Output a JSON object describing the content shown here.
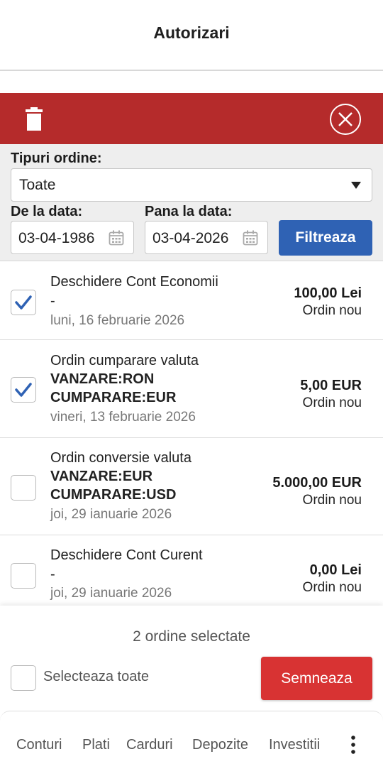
{
  "header": {
    "title": "Autorizari"
  },
  "toolbar": {
    "delete_icon": "trash-icon",
    "close_icon": "close-circle-icon",
    "color": "#b52b2b"
  },
  "filters": {
    "type_label": "Tipuri ordine:",
    "type_value": "Toate",
    "from_label": "De la data:",
    "from_value": "03-04-1986",
    "to_label": "Pana la data:",
    "to_value": "03-04-2026",
    "filter_button": "Filtreaza"
  },
  "orders": [
    {
      "title": "Deschidere Cont Economii",
      "line1": "-",
      "line2": "",
      "date": "luni, 16 februarie 2026",
      "amount": "100,00 Lei",
      "status": "Ordin nou",
      "checked": true
    },
    {
      "title": "Ordin cumparare valuta",
      "line1": "VANZARE:RON",
      "line2": "CUMPARARE:EUR",
      "date": "vineri, 13 februarie 2026",
      "amount": "5,00 EUR",
      "status": "Ordin nou",
      "checked": true
    },
    {
      "title": "Ordin conversie valuta",
      "line1": "VANZARE:EUR",
      "line2": "CUMPARARE:USD",
      "date": "joi, 29 ianuarie 2026",
      "amount": "5.000,00 EUR",
      "status": "Ordin nou",
      "checked": false
    },
    {
      "title": "Deschidere Cont Curent",
      "line1": "-",
      "line2": "",
      "date": "joi, 29 ianuarie 2026",
      "amount": "0,00 Lei",
      "status": "Ordin nou",
      "checked": false
    }
  ],
  "footer": {
    "selected_count": "2 ordine selectate",
    "select_all_label": "Selecteaza toate",
    "sign_button": "Semneaza"
  },
  "nav": {
    "items": [
      "Conturi",
      "Plati",
      "Carduri",
      "Depozite",
      "Investitii"
    ],
    "more_icon": "more-vertical-icon"
  }
}
